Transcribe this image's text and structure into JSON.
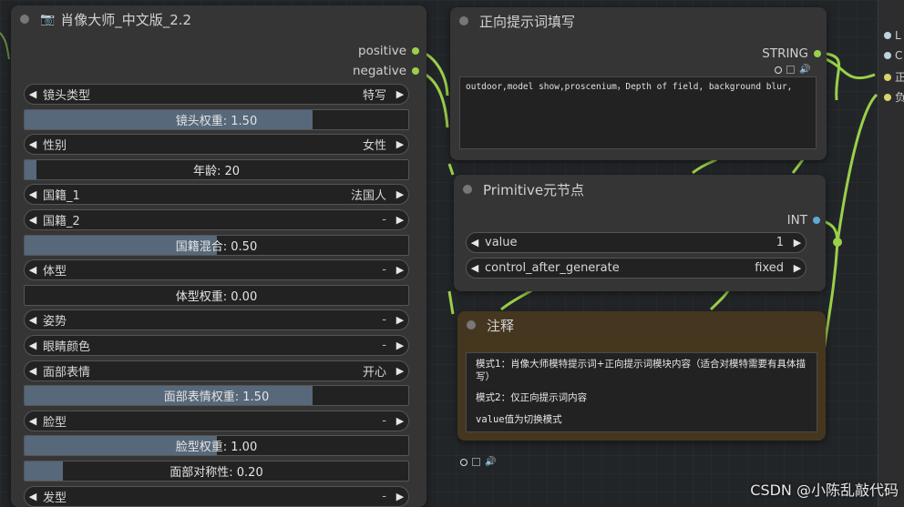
{
  "portrait_node": {
    "title": "肖像大师_中文版_2.2",
    "outputs": [
      "positive",
      "negative"
    ],
    "widgets": [
      {
        "type": "combo",
        "label": "镜头类型",
        "value": "特写"
      },
      {
        "type": "slider",
        "label": "镜头权重: 1.50",
        "fill": 0.75
      },
      {
        "type": "combo",
        "label": "性别",
        "value": "女性"
      },
      {
        "type": "slider",
        "label": "年龄: 20",
        "fill": 0.03
      },
      {
        "type": "combo",
        "label": "国籍_1",
        "value": "法国人"
      },
      {
        "type": "combo",
        "label": "国籍_2",
        "value": "-"
      },
      {
        "type": "slider",
        "label": "国籍混合: 0.50",
        "fill": 0.5
      },
      {
        "type": "combo",
        "label": "体型",
        "value": "-"
      },
      {
        "type": "slider",
        "label": "体型权重: 0.00",
        "fill": 0.0
      },
      {
        "type": "combo",
        "label": "姿势",
        "value": "-"
      },
      {
        "type": "combo",
        "label": "眼睛颜色",
        "value": "-"
      },
      {
        "type": "combo",
        "label": "面部表情",
        "value": "开心"
      },
      {
        "type": "slider",
        "label": "面部表情权重: 1.50",
        "fill": 0.75
      },
      {
        "type": "combo",
        "label": "脸型",
        "value": "-"
      },
      {
        "type": "slider",
        "label": "脸型权重: 1.00",
        "fill": 0.5
      },
      {
        "type": "slider",
        "label": "面部对称性: 0.20",
        "fill": 0.1
      },
      {
        "type": "combo",
        "label": "发型",
        "value": "-"
      }
    ]
  },
  "prompt_node": {
    "title": "正向提示词填写",
    "output": "STRING",
    "text": "outdoor,model show,proscenium，Depth of field, background blur,"
  },
  "primitive_node": {
    "title": "Primitive元节点",
    "output": "INT",
    "widgets": [
      {
        "label": "value",
        "value": "1"
      },
      {
        "label": "control_after_generate",
        "value": "fixed"
      }
    ]
  },
  "note_node": {
    "title": "注释",
    "line1": "模式1：肖像大师模特提示词+正向提示词模块内容（适合对模特需要有具体描写）",
    "line2": "模式2：仅正向提示词内容",
    "line3": "value值为切换模式"
  },
  "right_panel": {
    "items": [
      "L",
      "C",
      "正",
      "负"
    ]
  },
  "watermark": "CSDN @小陈乱敲代码",
  "colors": {
    "link_green": "#9ad04a",
    "slot_blue": "#5ea9d6",
    "slider_fill": "#56687a",
    "note_bg": "#45371f"
  }
}
